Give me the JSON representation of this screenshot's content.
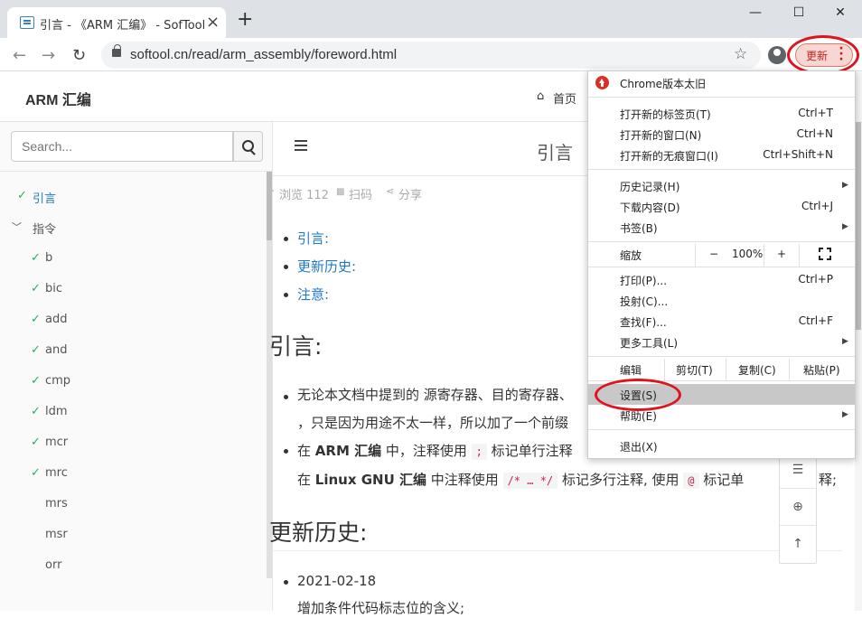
{
  "browser": {
    "tab_title": "引言 - 《ARM 汇编》 - SofTool.CN",
    "tab_close": "×",
    "new_tab": "+",
    "window": {
      "minimize": "—",
      "maximize": "☐",
      "close": "✕"
    },
    "url": "softool.cn/read/arm_assembly/foreword.html",
    "update_label": "更新",
    "nav": {
      "back": "←",
      "forward": "→",
      "reload": "↻"
    },
    "star": "☆"
  },
  "menu": {
    "update_notice": "Chrome版本太旧",
    "new_tab": {
      "label": "打开新的标签页(T)",
      "shortcut": "Ctrl+T"
    },
    "new_window": {
      "label": "打开新的窗口(N)",
      "shortcut": "Ctrl+N"
    },
    "incognito": {
      "label": "打开新的无痕窗口(I)",
      "shortcut": "Ctrl+Shift+N"
    },
    "history": {
      "label": "历史记录(H)"
    },
    "downloads": {
      "label": "下载内容(D)",
      "shortcut": "Ctrl+J"
    },
    "bookmarks": {
      "label": "书签(B)"
    },
    "zoom": {
      "label": "缩放",
      "minus": "−",
      "value": "100%",
      "plus": "+"
    },
    "print": {
      "label": "打印(P)...",
      "shortcut": "Ctrl+P"
    },
    "cast": {
      "label": "投射(C)..."
    },
    "find": {
      "label": "查找(F)...",
      "shortcut": "Ctrl+F"
    },
    "more_tools": {
      "label": "更多工具(L)"
    },
    "edit": {
      "label": "编辑",
      "cut": "剪切(T)",
      "copy": "复制(C)",
      "paste": "粘贴(P)"
    },
    "settings": {
      "label": "设置(S)"
    },
    "help": {
      "label": "帮助(E)"
    },
    "exit": {
      "label": "退出(X)"
    }
  },
  "site": {
    "title": "ARM 汇编",
    "home_link": "首页",
    "search_placeholder": "Search..."
  },
  "sidebar": {
    "items": [
      {
        "label": "引言",
        "checked": true,
        "active": true
      },
      {
        "label": "指令",
        "expandable": true
      },
      {
        "label": "b",
        "checked": true
      },
      {
        "label": "bic",
        "checked": true
      },
      {
        "label": "add",
        "checked": true
      },
      {
        "label": "and",
        "checked": true
      },
      {
        "label": "cmp",
        "checked": true
      },
      {
        "label": "ldm",
        "checked": true
      },
      {
        "label": "mcr",
        "checked": true
      },
      {
        "label": "mrc",
        "checked": true
      },
      {
        "label": "mrs",
        "checked": false
      },
      {
        "label": "msr",
        "checked": false
      },
      {
        "label": "orr",
        "checked": false
      }
    ]
  },
  "content": {
    "page_title": "引言",
    "meta": {
      "views": "浏览 112",
      "scan": "扫码",
      "share": "分享"
    },
    "toc": [
      "引言:",
      "更新历史:",
      "注意:"
    ],
    "h2_intro": "引言:",
    "bullet1_line1": "无论本文档中提到的 源寄存器、目的寄存器、",
    "bullet1_line2": "，只是因为用途不太一样，所以加了一个前缀",
    "bullet2_p1": "在 ",
    "bullet2_b1": "ARM 汇编",
    "bullet2_p2": " 中，注释使用",
    "bullet2_code1": ";",
    "bullet2_p3": "标记单行注释",
    "bullet2_l2_p1": "在 ",
    "bullet2_l2_b1": "Linux GNU 汇编",
    "bullet2_l2_p2": " 中注释使用",
    "bullet2_code2": "/* … */",
    "bullet2_l2_p3": "标记多行注释, 使用",
    "bullet2_code3": "@",
    "bullet2_l2_p4": "标记单",
    "bullet2_l2_p5": "释;",
    "h2_history": "更新历史:",
    "history_date": "2021-02-18",
    "history_desc": "增加条件代码标志位的含义;"
  },
  "icons": [
    "tab-favicon-icon",
    "lock-icon",
    "star-icon",
    "profile-icon",
    "kebab-icon",
    "home-icon",
    "search-icon",
    "hamburger-icon",
    "eye-icon",
    "qrcode-icon",
    "share-icon",
    "check-icon",
    "chevron-down-icon",
    "update-arrow-icon",
    "fullscreen-icon",
    "list-icon",
    "plus-circle-icon",
    "arrow-up-icon"
  ],
  "colors": {
    "accent_link": "#1e7ac7",
    "check": "#27ae60",
    "update": "#c5221f",
    "annotation_red": "#e0141e"
  }
}
